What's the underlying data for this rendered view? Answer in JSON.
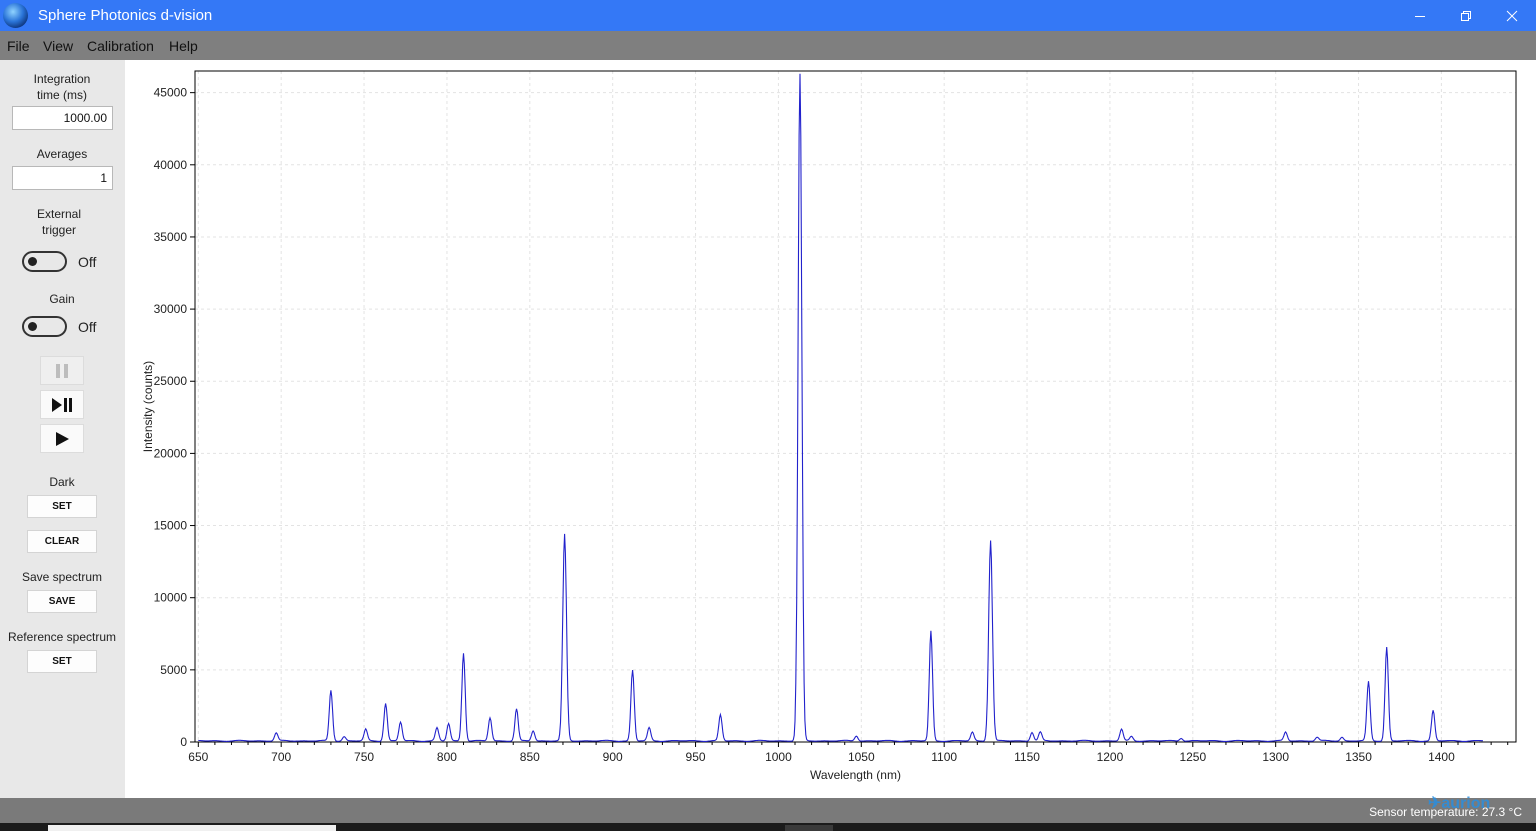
{
  "window": {
    "title": "Sphere Photonics d-vision"
  },
  "menu": [
    "File",
    "View",
    "Calibration",
    "Help"
  ],
  "sidebar": {
    "integration_label": "Integration\ntime (ms)",
    "integration_value": "1000.00",
    "averages_label": "Averages",
    "averages_value": "1",
    "external_trigger_label": "External\ntrigger",
    "external_trigger_state": "Off",
    "gain_label": "Gain",
    "gain_state": "Off",
    "dark_label": "Dark",
    "dark_set": "SET",
    "dark_clear": "CLEAR",
    "save_label": "Save spectrum",
    "save_button": "SAVE",
    "reference_label": "Reference spectrum",
    "reference_set": "SET"
  },
  "status": {
    "sensor_temperature": "Sensor temperature: 27.3 °C"
  },
  "watermark": "aurion",
  "chart_data": {
    "type": "line",
    "xlabel": "Wavelength (nm)",
    "ylabel": "Intensity (counts)",
    "xlim": [
      648,
      1445
    ],
    "ylim": [
      0,
      46500
    ],
    "xticks": [
      650,
      700,
      750,
      800,
      850,
      900,
      950,
      1000,
      1050,
      1100,
      1150,
      1200,
      1250,
      1300,
      1350,
      1400
    ],
    "yticks": [
      0,
      5000,
      10000,
      15000,
      20000,
      25000,
      30000,
      35000,
      40000,
      45000
    ],
    "grid": true,
    "x_range": [
      650,
      1425
    ],
    "baseline": 80,
    "series": [
      {
        "color": "#2222cc",
        "peaks": [
          {
            "x": 697,
            "y": 550
          },
          {
            "x": 730,
            "y": 3500
          },
          {
            "x": 738,
            "y": 300
          },
          {
            "x": 751,
            "y": 800
          },
          {
            "x": 763,
            "y": 2600
          },
          {
            "x": 772,
            "y": 1300
          },
          {
            "x": 794,
            "y": 900
          },
          {
            "x": 801,
            "y": 1200
          },
          {
            "x": 810,
            "y": 6100
          },
          {
            "x": 826,
            "y": 1600
          },
          {
            "x": 842,
            "y": 2200
          },
          {
            "x": 852,
            "y": 700
          },
          {
            "x": 871,
            "y": 14300
          },
          {
            "x": 912,
            "y": 4900
          },
          {
            "x": 922,
            "y": 900
          },
          {
            "x": 965,
            "y": 1800
          },
          {
            "x": 1013,
            "y": 46200
          },
          {
            "x": 1047,
            "y": 350
          },
          {
            "x": 1092,
            "y": 7600
          },
          {
            "x": 1117,
            "y": 600
          },
          {
            "x": 1128,
            "y": 13900
          },
          {
            "x": 1153,
            "y": 600
          },
          {
            "x": 1158,
            "y": 600
          },
          {
            "x": 1207,
            "y": 800
          },
          {
            "x": 1213,
            "y": 300
          },
          {
            "x": 1243,
            "y": 200
          },
          {
            "x": 1306,
            "y": 600
          },
          {
            "x": 1325,
            "y": 250
          },
          {
            "x": 1340,
            "y": 250
          },
          {
            "x": 1356,
            "y": 4100
          },
          {
            "x": 1367,
            "y": 6500
          },
          {
            "x": 1395,
            "y": 2100
          }
        ]
      }
    ]
  }
}
